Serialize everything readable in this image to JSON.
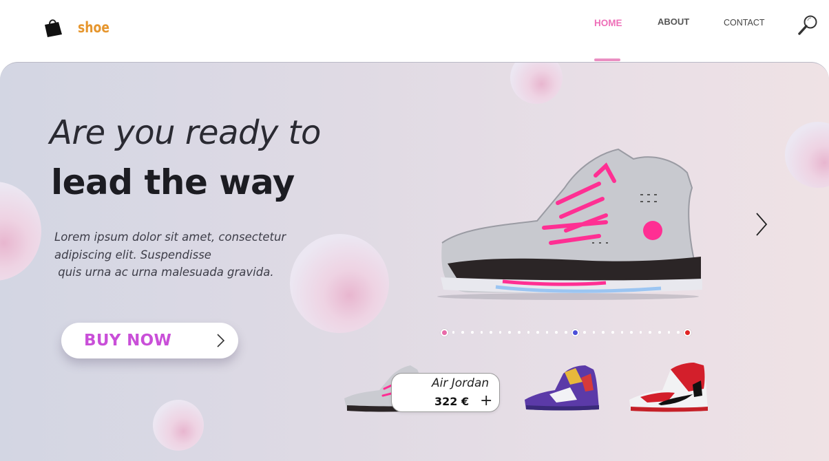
{
  "brand": {
    "name": "shoe",
    "icon": "shopping-bag-icon",
    "color": "#e6962e"
  },
  "nav": {
    "items": [
      {
        "label": "HOME",
        "active": true
      },
      {
        "label": "ABOUT",
        "active": false
      },
      {
        "label": "CONTACT",
        "active": false
      }
    ],
    "search_icon": "search-icon",
    "active_color": "#ee6fb8"
  },
  "hero": {
    "headline_line1": "Are you ready to",
    "headline_line2": "lead the way",
    "description_lines": [
      "Lorem ipsum dolor sit amet, consectetur",
      "adipiscing elit. Suspendisse",
      " quis urna ac urna malesuada gravida."
    ],
    "cta_label": "BUY NOW",
    "cta_color": "#c94fd8",
    "next_icon": "chevron-right-icon"
  },
  "carousel": {
    "dot_count": 27,
    "highlighted_dots": [
      {
        "index": 0,
        "color": "#e86aa8"
      },
      {
        "index": 14,
        "color": "#4b4fd8"
      },
      {
        "index": 26,
        "color": "#e02424"
      }
    ],
    "active_index": 14
  },
  "products": [
    {
      "name": "Air Jordan",
      "price": "322 €",
      "add_label": "+",
      "colorway": "silver-pink"
    },
    {
      "colorway": "purple-multicolor"
    },
    {
      "colorway": "black-red-white"
    }
  ]
}
